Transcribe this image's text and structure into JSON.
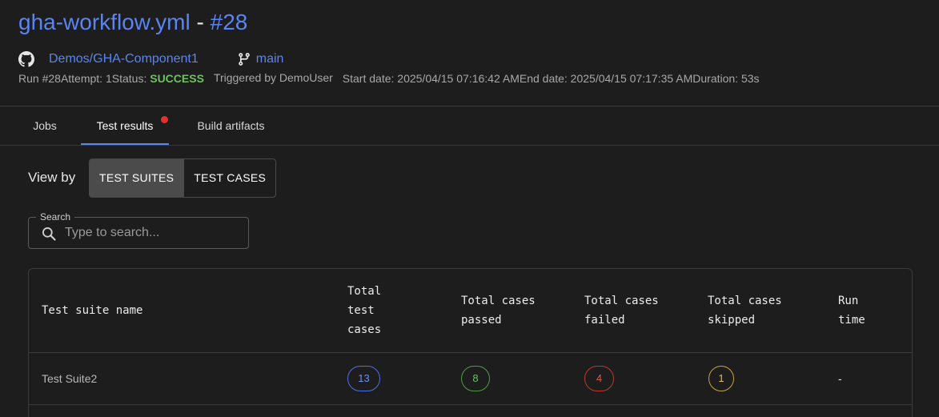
{
  "header": {
    "workflow_name": "gha-workflow.yml",
    "separator": " - ",
    "run_label": "#28",
    "repo": "Demos/GHA-Component1",
    "branch": "main",
    "meta": {
      "run": "Run #28",
      "attempt": "Attempt: 1",
      "status_label": "Status:",
      "status_value": "SUCCESS",
      "triggered_by": "Triggered by DemoUser",
      "start_date": "Start date: 2025/04/15 07:16:42 AM",
      "end_date": "End date: 2025/04/15 07:17:35 AM",
      "duration": "Duration: 53s"
    }
  },
  "tabs": [
    {
      "label": "Jobs",
      "active": false
    },
    {
      "label": "Test results",
      "active": true,
      "has_notification": true
    },
    {
      "label": "Build artifacts",
      "active": false
    }
  ],
  "view_by": {
    "label": "View by",
    "options": [
      "TEST SUITES",
      "TEST CASES"
    ],
    "selected": "TEST SUITES"
  },
  "search": {
    "legend": "Search",
    "placeholder": "Type to search...",
    "value": ""
  },
  "table": {
    "columns": [
      [
        "Test suite name"
      ],
      [
        "Total",
        "test",
        "cases"
      ],
      [
        "Total cases",
        "passed"
      ],
      [
        "Total cases",
        "failed"
      ],
      [
        "Total cases",
        "skipped"
      ],
      [
        "Run",
        "time"
      ]
    ],
    "rows": [
      {
        "name": "Test Suite2",
        "total": "13",
        "passed": "8",
        "failed": "4",
        "skipped": "1",
        "run_time": "-"
      }
    ]
  },
  "colors": {
    "accent": "#5b84f0",
    "success": "#6ec15f",
    "failed": "#e0554a",
    "skipped": "#e3bd55",
    "notification": "#e5312b",
    "background": "#1d1d1d"
  }
}
